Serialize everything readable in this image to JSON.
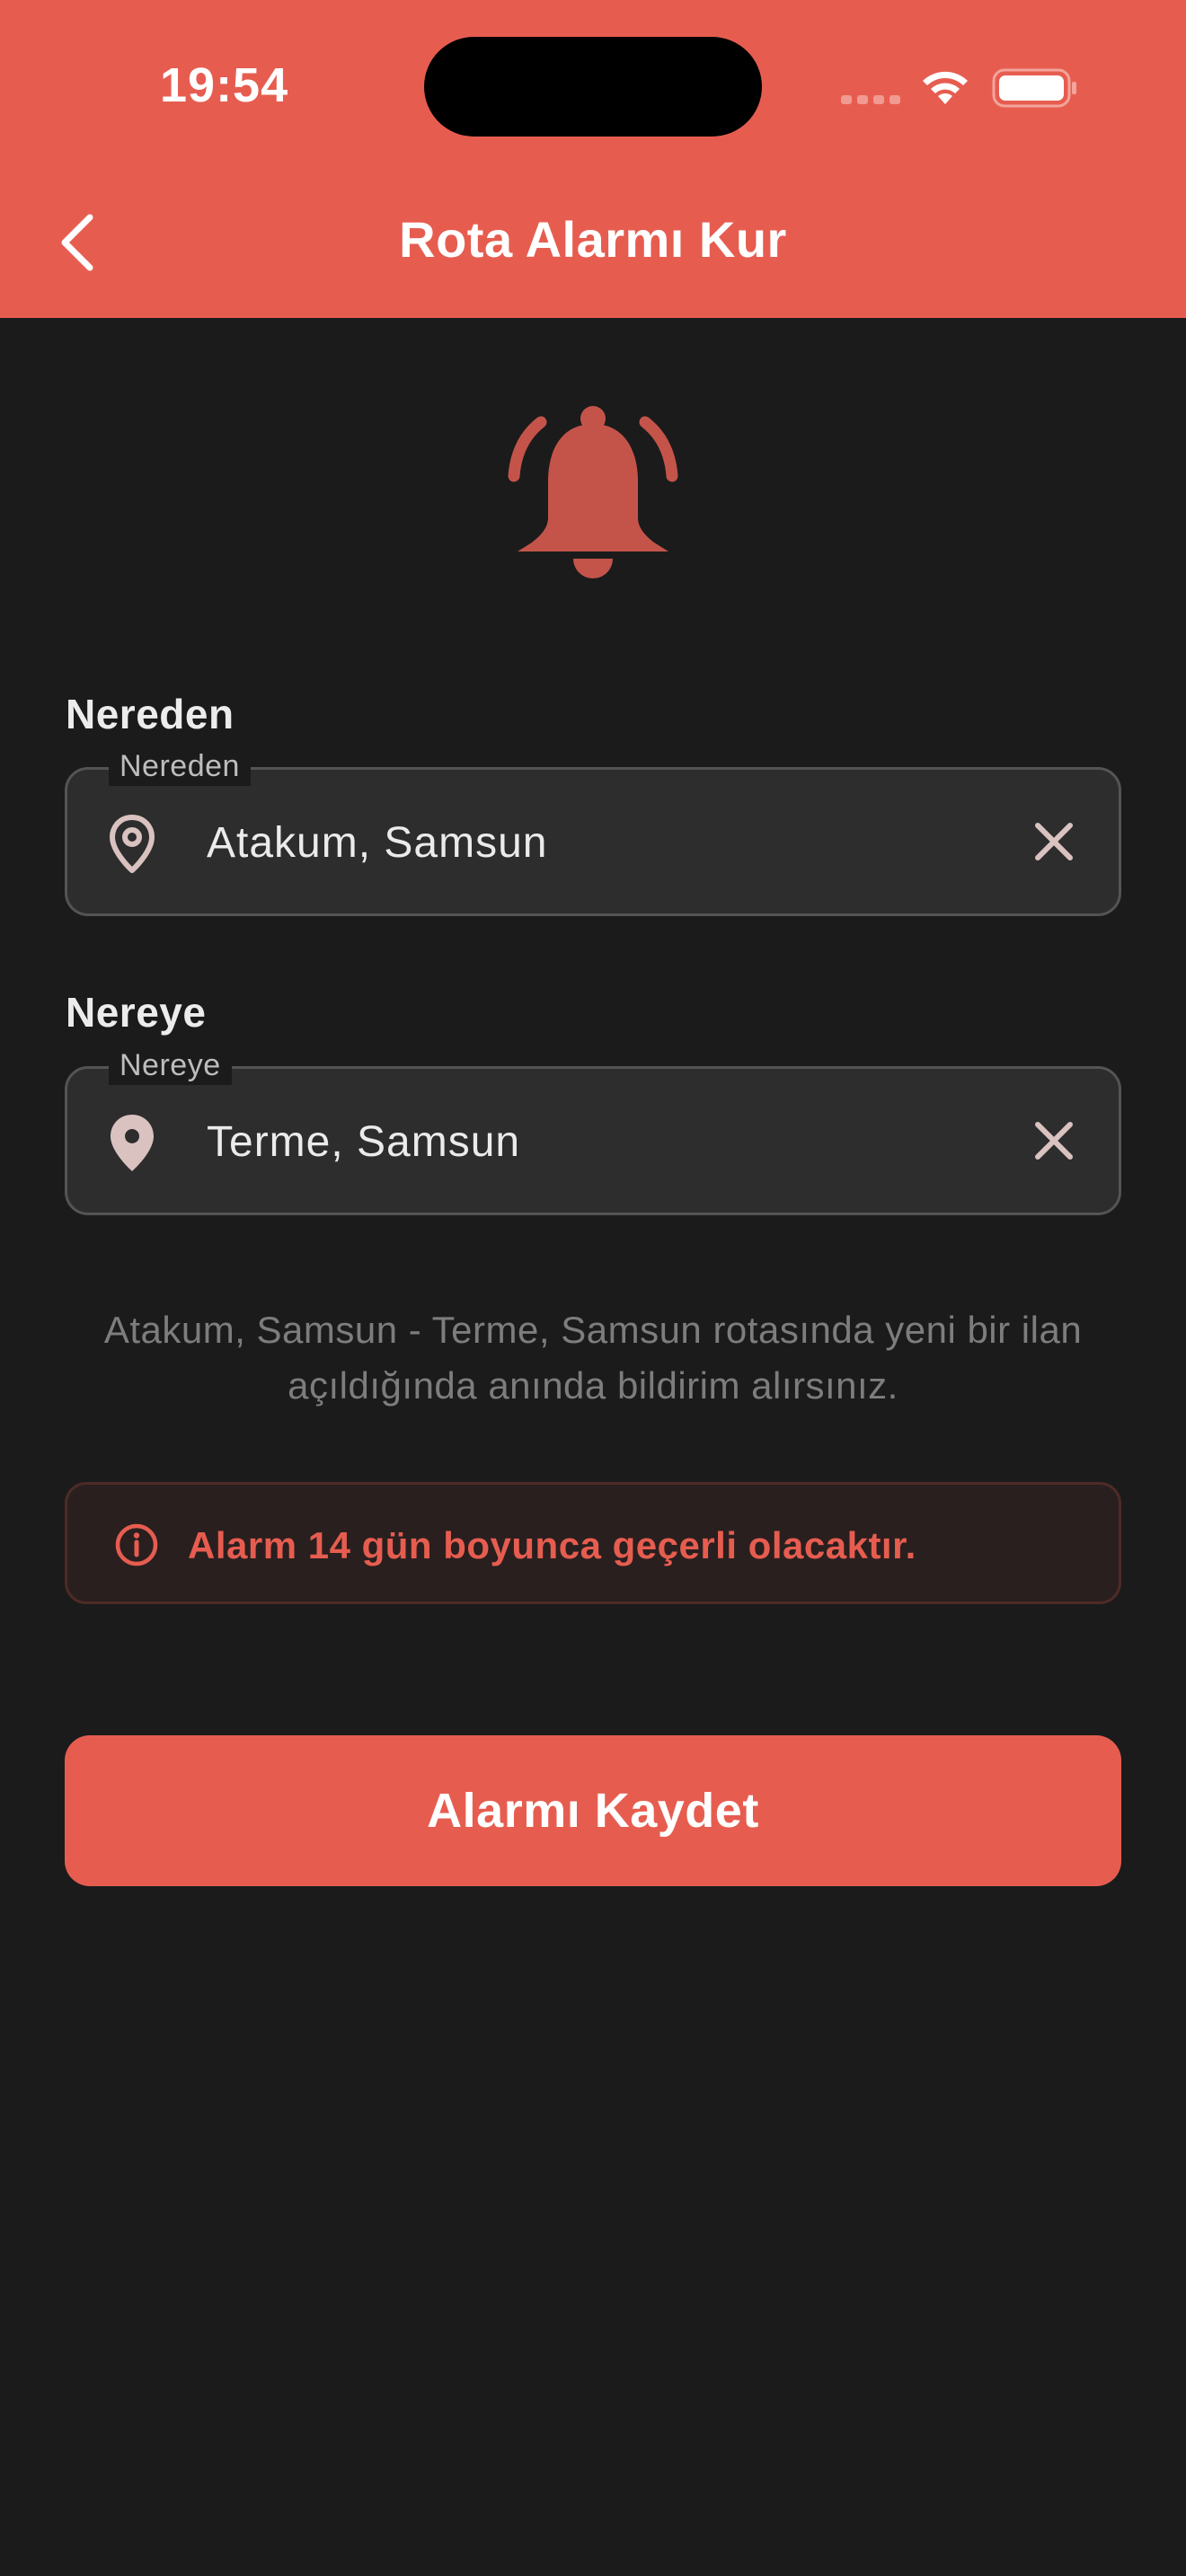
{
  "status_bar": {
    "time": "19:54",
    "icons": [
      "signal-icon",
      "wifi-icon",
      "battery-icon"
    ]
  },
  "header": {
    "title": "Rota Alarmı Kur",
    "back_icon": "chevron-left-icon"
  },
  "hero": {
    "icon": "ringing-bell-icon"
  },
  "from": {
    "section_label": "Nereden",
    "field_label": "Nereden",
    "value": "Atakum, Samsun",
    "icon": "location-pin-outline-icon",
    "clear_icon": "close-icon"
  },
  "to": {
    "section_label": "Nereye",
    "field_label": "Nereye",
    "value": "Terme, Samsun",
    "icon": "location-pin-filled-icon",
    "clear_icon": "close-icon"
  },
  "info": {
    "text": "Atakum, Samsun - Terme, Samsun rotasında yeni bir ilan açıldığında anında bildirim alırsınız."
  },
  "notice": {
    "icon": "info-icon",
    "text": "Alarm 14 gün boyunca geçerli olacaktır."
  },
  "actions": {
    "save_label": "Alarmı Kaydet"
  },
  "colors": {
    "accent": "#e65d50",
    "background": "#1b1b1b",
    "field_background": "#2d2d2d",
    "notice_background": "#2a1f1f"
  }
}
